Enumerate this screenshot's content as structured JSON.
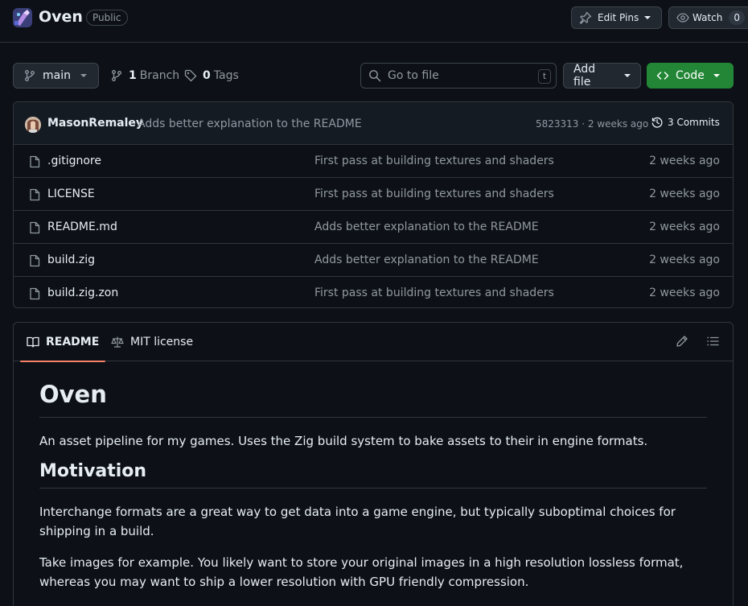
{
  "header": {
    "repo_name": "Oven",
    "visibility": "Public",
    "edit_pins_label": "Edit Pins",
    "watch_label": "Watch",
    "watch_count": "0"
  },
  "toolbar": {
    "branch": "main",
    "branch_count": "1",
    "branch_label": "Branch",
    "tag_count": "0",
    "tag_label": "Tags",
    "search_placeholder": "Go to file",
    "search_shortcut": "t",
    "add_file_label": "Add file",
    "code_label": "Code"
  },
  "latest_commit": {
    "author": "MasonRemaley",
    "message": "Adds better explanation to the README",
    "sha_time": "5823313 · 2 weeks ago",
    "commits_label": "3 Commits"
  },
  "files": [
    {
      "name": ".gitignore",
      "message": "First pass at building textures and shaders",
      "time": "2 weeks ago"
    },
    {
      "name": "LICENSE",
      "message": "First pass at building textures and shaders",
      "time": "2 weeks ago"
    },
    {
      "name": "README.md",
      "message": "Adds better explanation to the README",
      "time": "2 weeks ago"
    },
    {
      "name": "build.zig",
      "message": "Adds better explanation to the README",
      "time": "2 weeks ago"
    },
    {
      "name": "build.zig.zon",
      "message": "First pass at building textures and shaders",
      "time": "2 weeks ago"
    }
  ],
  "readme": {
    "tab_readme": "README",
    "tab_license": "MIT license",
    "title": "Oven",
    "intro": "An asset pipeline for my games. Uses the Zig build system to bake assets to their in engine formats.",
    "h2_motivation": "Motivation",
    "p1": "Interchange formats are a great way to get data into a game engine, but typically suboptimal choices for shipping in a build.",
    "p2": "Take images for example. You likely want to store your original images in a high resolution lossless format, whereas you may want to ship a lower resolution with GPU friendly compression."
  },
  "colors": {
    "background": "#0d1117",
    "accent_green": "#238636",
    "tab_underline": "#f78166",
    "muted_text": "#9198a1",
    "border": "#30363d"
  },
  "icons": [
    "repo-avatar",
    "pin-icon",
    "eye-icon",
    "branch-icon",
    "tag-icon",
    "search-icon",
    "code-icon",
    "history-icon",
    "file-icon",
    "book-icon",
    "law-icon",
    "pencil-icon",
    "list-icon"
  ]
}
